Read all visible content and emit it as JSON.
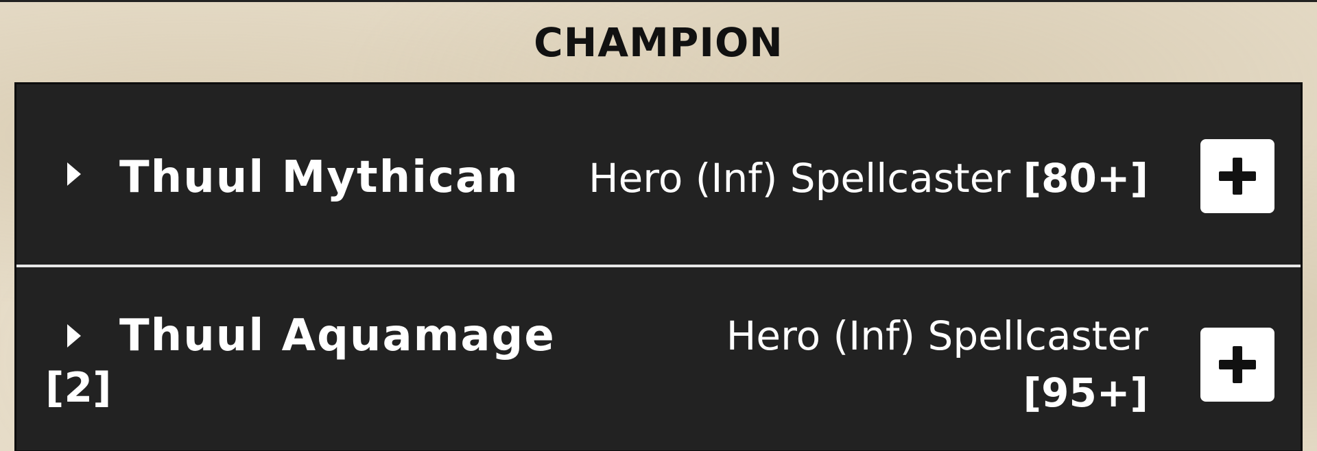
{
  "section": {
    "title": "CHAMPION"
  },
  "units": [
    {
      "name": "Thuul Mythican",
      "count": "",
      "type": "Hero (Inf) Spellcaster",
      "cost": "[80+]",
      "add_icon": "plus-icon",
      "expand_icon": "caret-right-icon"
    },
    {
      "name": "Thuul Aquamage",
      "count": "[2]",
      "type": "Hero (Inf) Spellcaster",
      "cost": "[95+]",
      "add_icon": "plus-icon",
      "expand_icon": "caret-right-icon"
    }
  ],
  "colors": {
    "panel_bg": "#222222",
    "text": "#ffffff",
    "page_bg": "#e6dcc8",
    "title_text": "#111111"
  }
}
